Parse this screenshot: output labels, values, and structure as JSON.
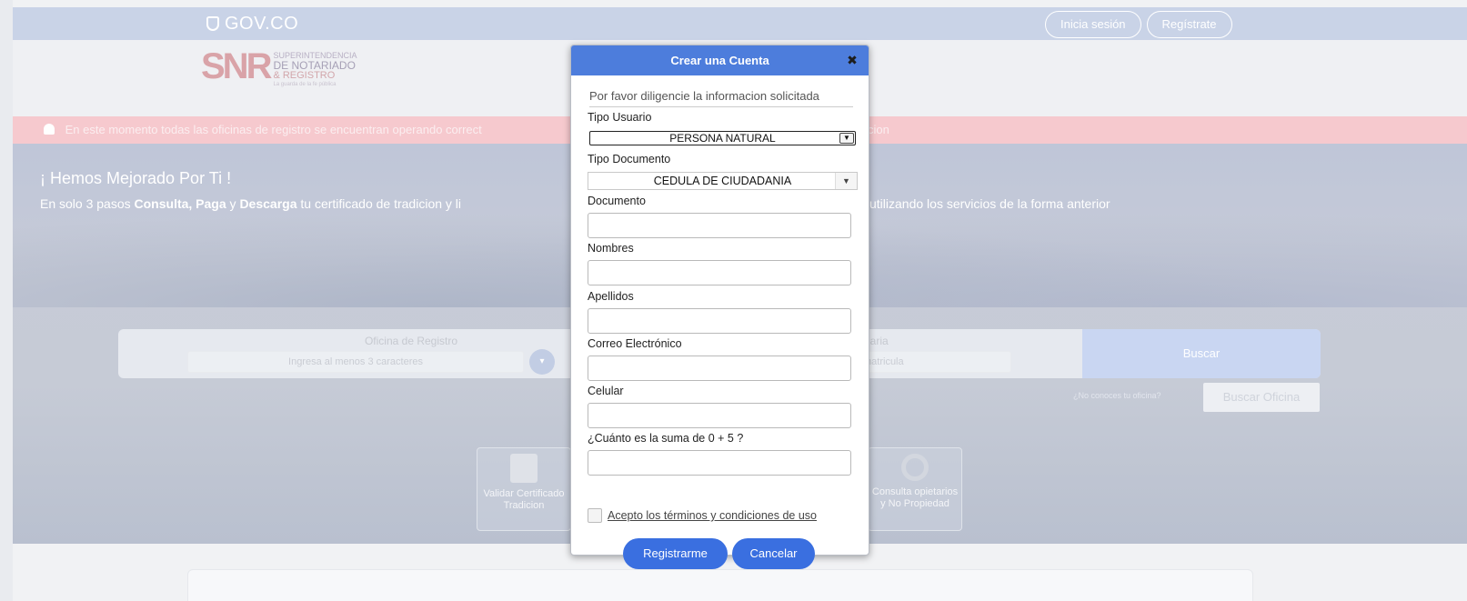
{
  "govbar": {
    "logo_text": "GOV.CO",
    "login_label": "Inicia sesión",
    "register_label": "Regístrate"
  },
  "brand": {
    "mark": "SNR",
    "line1": "SUPERINTENDENCIA",
    "line2": "DE NOTARIADO",
    "line3": "& REGISTRO",
    "line4": "La guarda de la fe pública"
  },
  "alert": {
    "text": "En este momento todas las oficinas de registro se encuentran operando correct",
    "tail": "cion"
  },
  "hero": {
    "title": "¡ Hemos Mejorado Por Ti !",
    "sub_prefix": "En solo 3 pasos ",
    "sub_b1": "Consulta, Paga",
    "sub_mid": " y ",
    "sub_b2": "Descarga",
    "sub_suffix": " tu certificado de tradicion y li",
    "sub_right": "utilizando los servicios de la forma anterior"
  },
  "search": {
    "office_label": "Oficina de Registro",
    "office_placeholder": "Ingresa al menos 3 caracteres",
    "right_label": "biliaria",
    "right_placeholder": "matricula",
    "buscar_label": "Buscar",
    "no_conoces": "¿No conoces tu oficina?",
    "buscar_oficina_label": "Buscar Oficina"
  },
  "tiles": [
    {
      "label": "Validar Certificado Tradicion",
      "icon": "certificate-icon"
    },
    {
      "label": "Consulta opietarios y No Propiedad",
      "icon": "magnifier-icon"
    }
  ],
  "modal": {
    "title": "Crear una Cuenta",
    "close": "✖",
    "intro": "Por favor diligencie la informacion solicitada",
    "tipo_usuario_label": "Tipo Usuario",
    "tipo_usuario_value": "PERSONA NATURAL",
    "tipo_documento_label": "Tipo Documento",
    "tipo_documento_value": "CEDULA DE CIUDADANIA",
    "documento_label": "Documento",
    "nombres_label": "Nombres",
    "apellidos_label": "Apellidos",
    "correo_label": "Correo Electrónico",
    "celular_label": "Celular",
    "captcha_label": "¿Cuánto es la suma de 0 + 5 ?",
    "terms_label": "Acepto los términos y condiciones de uso",
    "register_label": "Registrarme",
    "cancel_label": "Cancelar"
  },
  "colors": {
    "modal_header": "#4d7ddc",
    "primary_button": "#3a6fe0",
    "alert_bg": "#f6c9ce",
    "govbar_bg": "#c9d3e7"
  }
}
